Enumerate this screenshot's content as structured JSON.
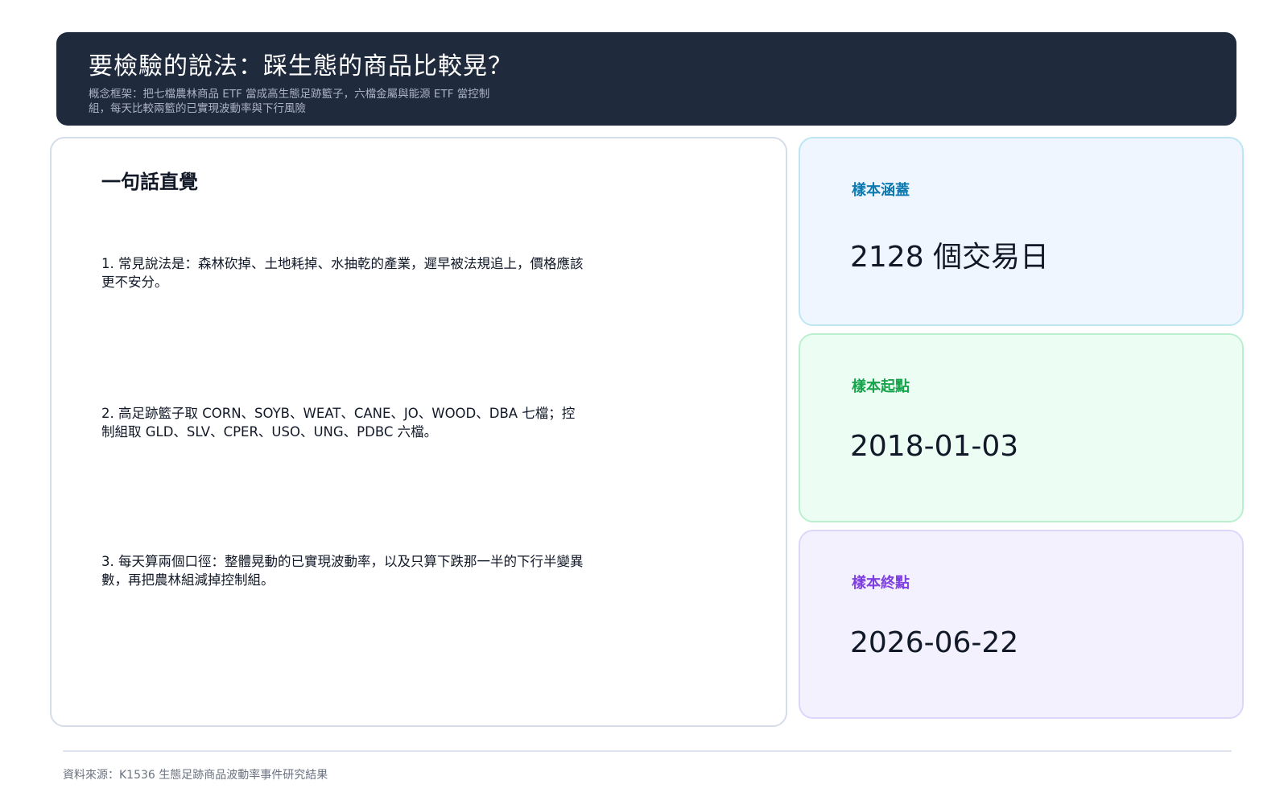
{
  "header": {
    "title": "要檢驗的說法：踩生態的商品比較晃？",
    "subtitle": "概念框架：把七檔農林商品 ETF 當成高生態足跡籃子，六檔金屬與能源 ETF 當控制組，每天比較兩籃的已實現波動率與下行風險"
  },
  "left_panel": {
    "title": "一句話直覺",
    "points": [
      "1. 常見說法是：森林砍掉、土地耗掉、水抽乾的產業，遲早被法規追上，價格應該更不安分。",
      "2. 高足跡籃子取 CORN、SOYB、WEAT、CANE、JO、WOOD、DBA 七檔；控制組取 GLD、SLV、CPER、USO、UNG、PDBC 六檔。",
      "3. 每天算兩個口徑：整體晃動的已實現波動率，以及只算下跌那一半的下行半變異數，再把農林組減掉控制組。"
    ]
  },
  "stats": [
    {
      "label": "樣本涵蓋",
      "value": "2128 個交易日"
    },
    {
      "label": "樣本起點",
      "value": "2018-01-03"
    },
    {
      "label": "樣本終點",
      "value": "2026-06-22"
    }
  ],
  "footer": {
    "source": "資料來源：K1536 生態足跡商品波動率事件研究結果"
  }
}
